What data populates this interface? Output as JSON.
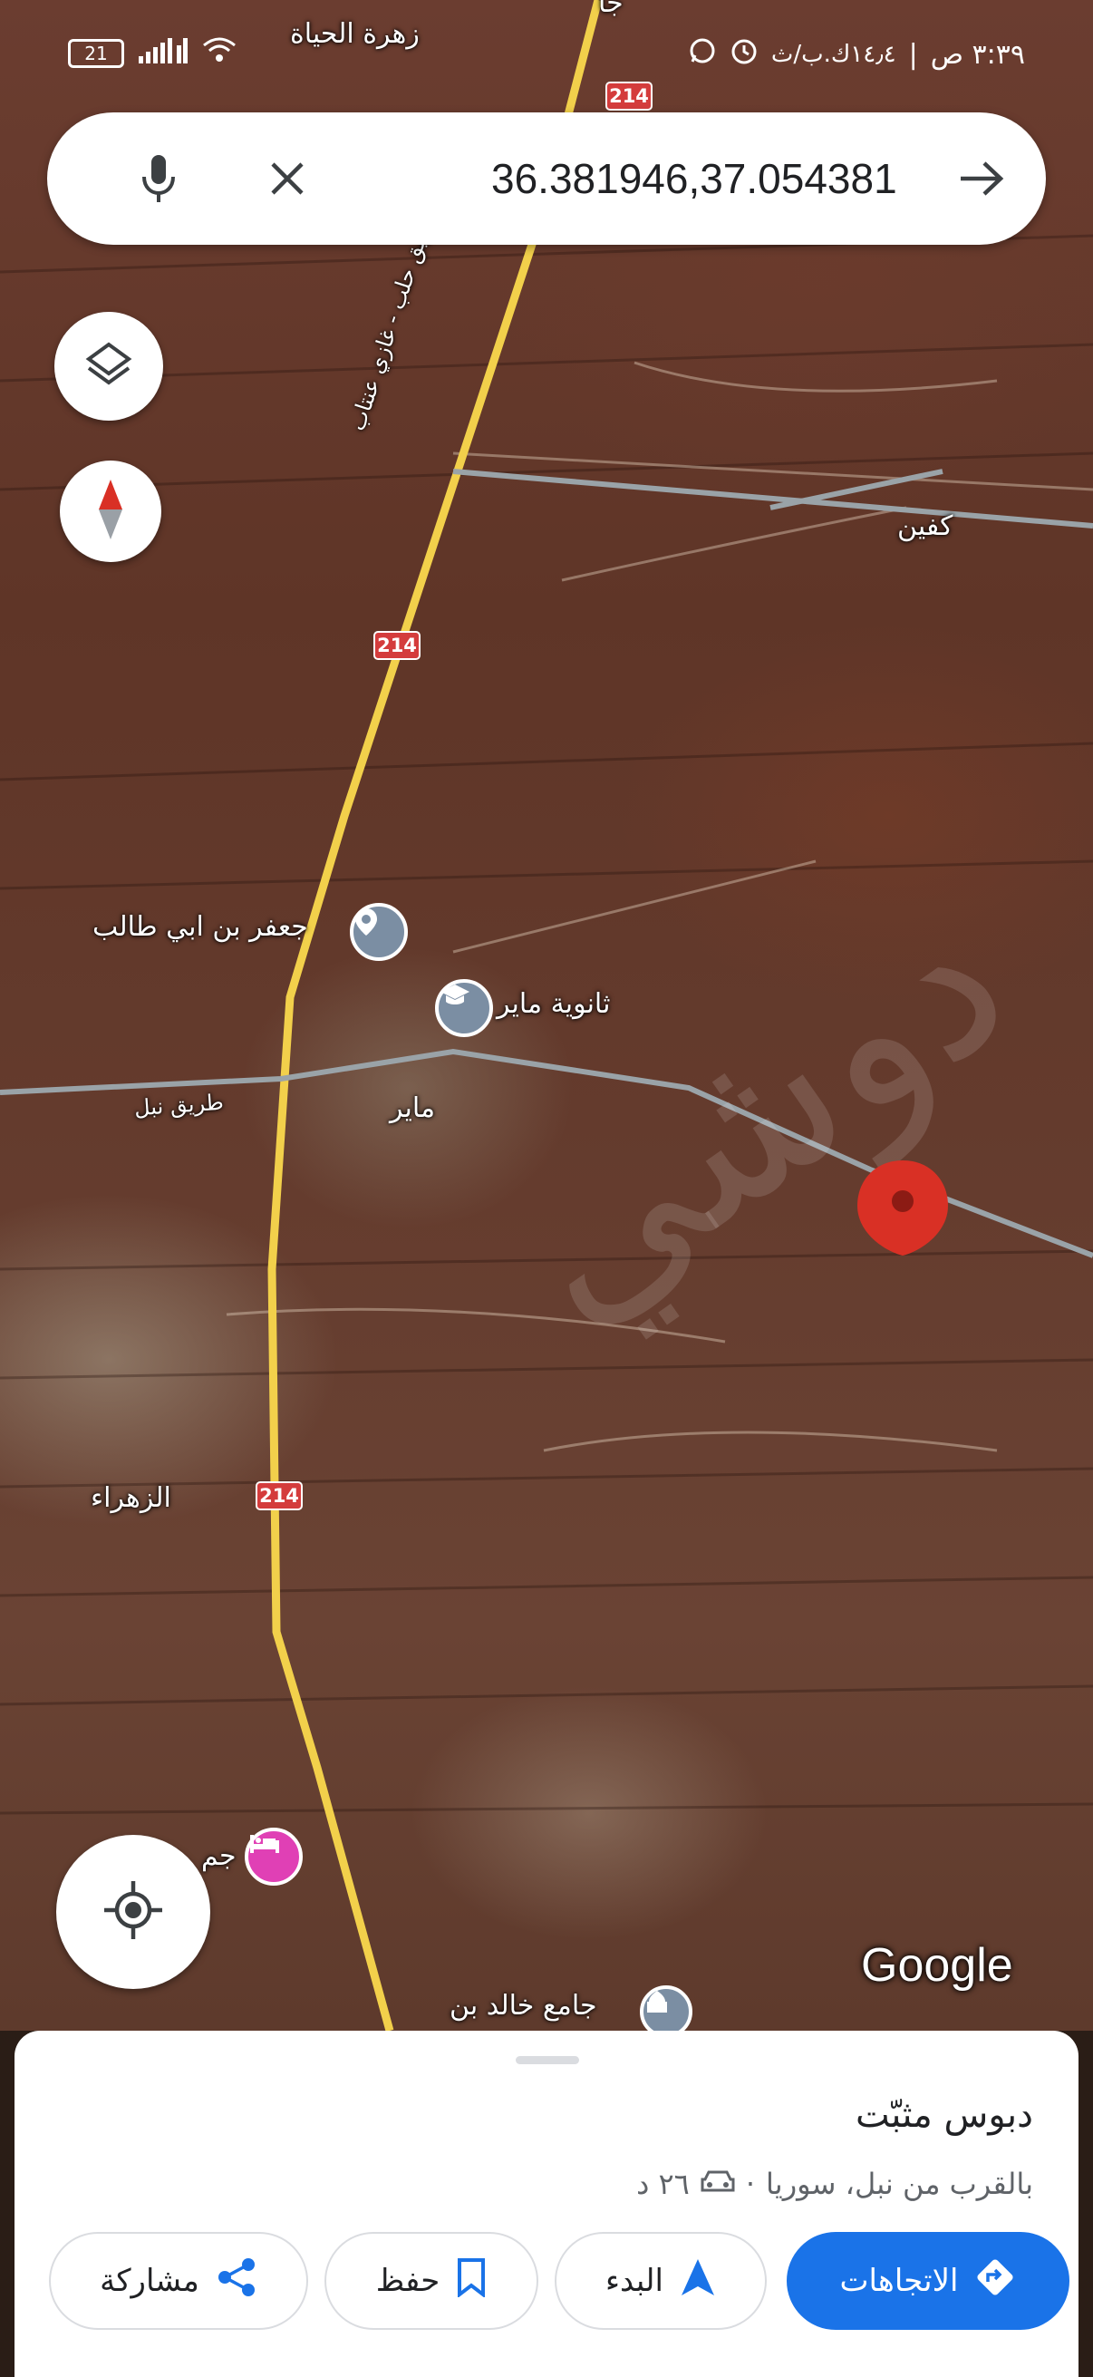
{
  "status_bar": {
    "time": "٣:٣٩ ص",
    "speed": "١٤٫٤ك.ب/ث",
    "battery": "21"
  },
  "search": {
    "query": "36.381946,37.054381"
  },
  "map": {
    "labels": {
      "zahrat_al_hayat": "زهرة الحياة",
      "kafin": "كفين",
      "jaafar": "جعفر بن ابي طالب",
      "thanawiya_mayer": "ثانوية ماير",
      "nubl_road": "طريق نبل",
      "mayer": "ماير",
      "zahraa": "الزهراء",
      "khalid_mosque": "جامع خالد بن",
      "partial_top": "جا",
      "road_name": "طريق حلب - غازي عنتاب",
      "hotel_partial": "جم"
    },
    "route_number": "214",
    "watermark": "دوشي",
    "google_logo": "Google"
  },
  "sheet": {
    "title": "دبوس مثبّت",
    "location": "بالقرب من نبل، سوريا",
    "separator": "·",
    "drive_time": "٢٦ د",
    "actions": {
      "directions": "الاتجاهات",
      "start": "البدء",
      "save": "حفظ",
      "share": "مشاركة"
    }
  },
  "colors": {
    "accent": "#1a73e8",
    "pin": "#d93025",
    "road_yellow": "#f2d04b",
    "poi_gray": "#7b8ea3",
    "poi_hotel": "#e040b5"
  },
  "icons": {
    "mic": "mic-icon",
    "clear": "close-icon",
    "go": "arrow-right-icon",
    "layers": "layers-icon",
    "compass": "compass-icon",
    "locate": "my-location-icon"
  }
}
